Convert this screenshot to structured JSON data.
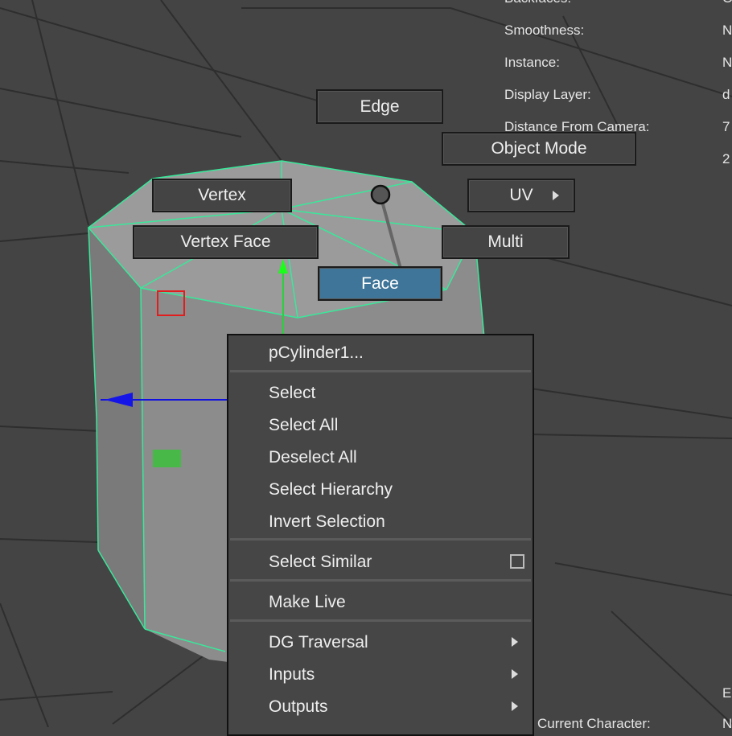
{
  "hud": {
    "rows": [
      {
        "label": "Backfaces:",
        "value": "O"
      },
      {
        "label": "Smoothness:",
        "value": "N"
      },
      {
        "label": "Instance:",
        "value": "N"
      },
      {
        "label": "Display Layer:",
        "value": "d"
      },
      {
        "label": "Distance From Camera:",
        "value": "7"
      },
      {
        "label": "",
        "value": "2"
      }
    ],
    "bottom_label": "Current Character:",
    "bottom_value": "N",
    "bottom_right": "E"
  },
  "marking_menu": {
    "edge": "Edge",
    "object_mode": "Object Mode",
    "vertex": "Vertex",
    "uv": "UV",
    "vertex_face": "Vertex Face",
    "multi": "Multi",
    "face": "Face"
  },
  "context_menu": {
    "header": "pCylinder1...",
    "items_group1": [
      "Select",
      "Select All",
      "Deselect All",
      "Select Hierarchy",
      "Invert Selection"
    ],
    "select_similar": "Select Similar",
    "make_live": "Make Live",
    "submenus": [
      "DG Traversal",
      "Inputs",
      "Outputs"
    ]
  },
  "colors": {
    "viewport_bg": "#444444",
    "active_button": "#3f7598",
    "wireframe": "#39e89a"
  }
}
